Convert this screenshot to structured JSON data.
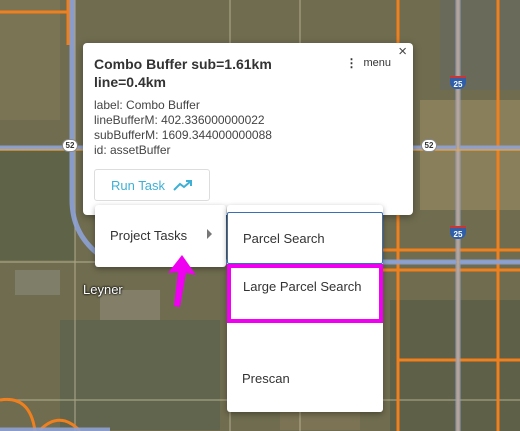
{
  "popup": {
    "title": "Combo Buffer sub=1.61km line=0.4km",
    "close_glyph": "×",
    "menu_label": "menu",
    "properties": [
      "label: Combo Buffer",
      "lineBufferM: 402.336000000022",
      "subBufferM: 1609.344000000088",
      "id: assetBuffer"
    ],
    "run_task_label": "Run Task",
    "run_task_icon": "trending-up-icon",
    "accent_color": "#3eb0d5"
  },
  "project_menu": {
    "label": "Project Tasks"
  },
  "submenu": {
    "items": [
      "Parcel Search",
      "Large Parcel Search",
      "Prescan"
    ],
    "highlight_color": "#f000f0"
  },
  "map": {
    "place_label": "Leyner",
    "shields": [
      "25",
      "25",
      "52",
      "52"
    ]
  },
  "annotation": {
    "arrow_color": "#f000f0"
  }
}
